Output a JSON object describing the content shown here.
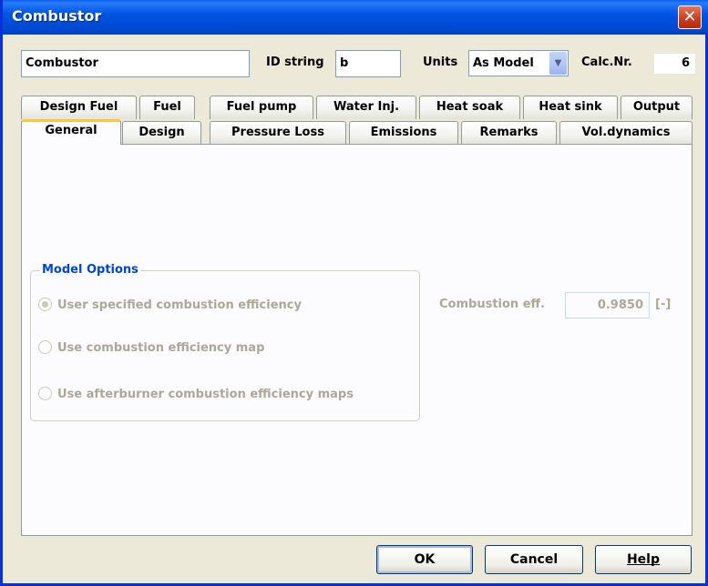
{
  "window": {
    "title": "Combustor",
    "close_label": "✕"
  },
  "header": {
    "name_value": "Combustor",
    "id_label": "ID string",
    "id_value": "b",
    "units_label": "Units",
    "units_value": "As Model",
    "calc_label": "Calc.Nr.",
    "calc_value": "6"
  },
  "tabs_row1": [
    "Design Fuel",
    "Fuel",
    "Fuel pump",
    "Water Inj.",
    "Heat soak",
    "Heat sink",
    "Output"
  ],
  "tabs_row2": [
    "General",
    "Design",
    "Pressure Loss",
    "Emissions",
    "Remarks",
    "Vol.dynamics"
  ],
  "active_tab": "General",
  "model_options": {
    "title": "Model Options",
    "options": [
      {
        "label": "User specified combustion efficiency",
        "checked": true
      },
      {
        "label": "Use combustion efficiency map",
        "checked": false
      },
      {
        "label": "Use afterburner combustion efficiency maps",
        "checked": false
      }
    ]
  },
  "efficiency": {
    "label": "Combustion eff.",
    "value": "0.9850",
    "unit": "[-]"
  },
  "buttons": {
    "ok": "OK",
    "cancel": "Cancel",
    "help": "Help"
  }
}
